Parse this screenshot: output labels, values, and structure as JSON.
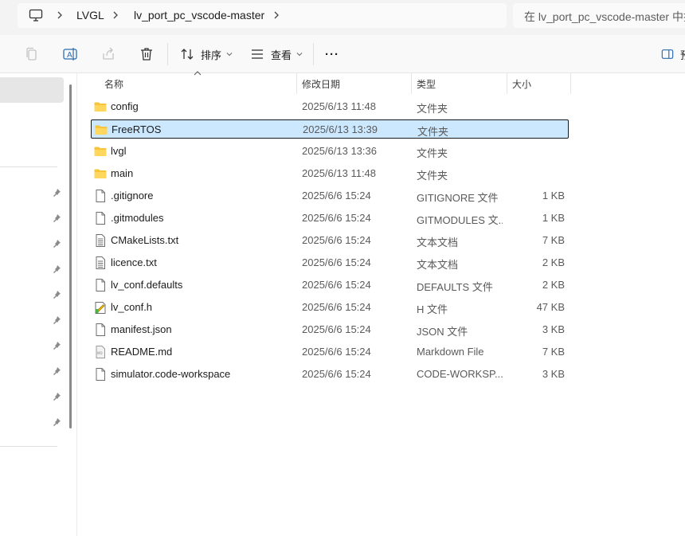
{
  "address_bar": {
    "breadcrumbs": [
      "LVGL",
      "lv_port_pc_vscode-master"
    ],
    "root_icon": "this-pc-icon"
  },
  "search": {
    "placeholder": "在 lv_port_pc_vscode-master 中搜索"
  },
  "toolbar": {
    "icons": [
      "copy-icon",
      "rename-icon",
      "share-icon",
      "delete-icon"
    ],
    "sort_label": "排序",
    "view_label": "查看",
    "more_label": "···",
    "preview_label": "预览"
  },
  "columns": {
    "name": "名称",
    "modified": "修改日期",
    "type": "类型",
    "size": "大小"
  },
  "files": [
    {
      "name": "config",
      "date": "2025/6/13 11:48",
      "type": "文件夹",
      "size": "",
      "icon": "folder-icon",
      "selected": false
    },
    {
      "name": "FreeRTOS",
      "date": "2025/6/13 13:39",
      "type": "文件夹",
      "size": "",
      "icon": "folder-icon",
      "selected": true
    },
    {
      "name": "lvgl",
      "date": "2025/6/13 13:36",
      "type": "文件夹",
      "size": "",
      "icon": "folder-icon",
      "selected": false
    },
    {
      "name": "main",
      "date": "2025/6/13 11:48",
      "type": "文件夹",
      "size": "",
      "icon": "folder-icon",
      "selected": false
    },
    {
      "name": ".gitignore",
      "date": "2025/6/6 15:24",
      "type": "GITIGNORE 文件",
      "size": "1 KB",
      "icon": "blank-file-icon",
      "selected": false
    },
    {
      "name": ".gitmodules",
      "date": "2025/6/6 15:24",
      "type": "GITMODULES 文...",
      "size": "1 KB",
      "icon": "blank-file-icon",
      "selected": false
    },
    {
      "name": "CMakeLists.txt",
      "date": "2025/6/6 15:24",
      "type": "文本文档",
      "size": "7 KB",
      "icon": "text-file-icon",
      "selected": false
    },
    {
      "name": "licence.txt",
      "date": "2025/6/6 15:24",
      "type": "文本文档",
      "size": "2 KB",
      "icon": "text-file-icon",
      "selected": false
    },
    {
      "name": "lv_conf.defaults",
      "date": "2025/6/6 15:24",
      "type": "DEFAULTS 文件",
      "size": "2 KB",
      "icon": "blank-file-icon",
      "selected": false
    },
    {
      "name": "lv_conf.h",
      "date": "2025/6/6 15:24",
      "type": "H 文件",
      "size": "47 KB",
      "icon": "header-file-icon",
      "selected": false
    },
    {
      "name": "manifest.json",
      "date": "2025/6/6 15:24",
      "type": "JSON 文件",
      "size": "3 KB",
      "icon": "blank-file-icon",
      "selected": false
    },
    {
      "name": "README.md",
      "date": "2025/6/6 15:24",
      "type": "Markdown File",
      "size": "7 KB",
      "icon": "markdown-file-icon",
      "selected": false
    },
    {
      "name": "simulator.code-workspace",
      "date": "2025/6/6 15:24",
      "type": "CODE-WORKSP...",
      "size": "3 KB",
      "icon": "blank-file-icon",
      "selected": false
    }
  ],
  "colors": {
    "selection_bg": "#cce8ff",
    "folder": "#f8c43a"
  }
}
